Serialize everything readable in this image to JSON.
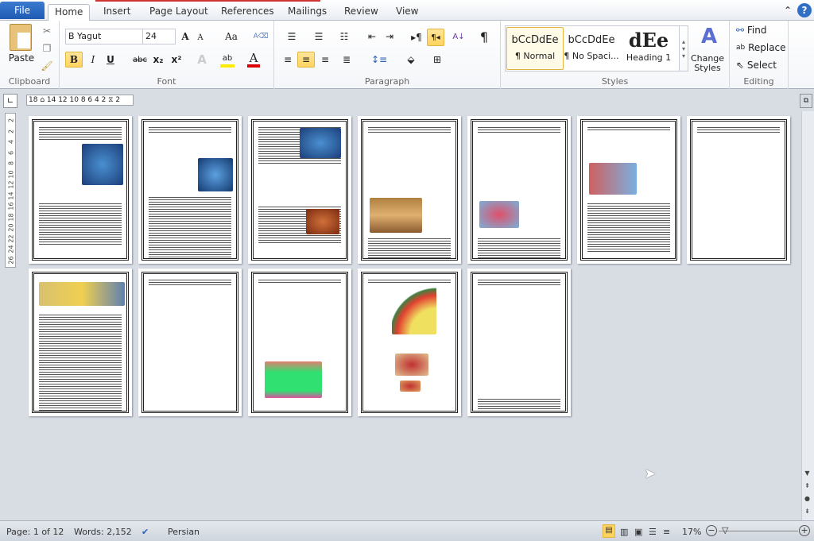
{
  "tabs": {
    "file": "File",
    "items": [
      "Home",
      "Insert",
      "Page Layout",
      "References",
      "Mailings",
      "Review",
      "View"
    ]
  },
  "clipboard": {
    "paste": "Paste",
    "label": "Clipboard"
  },
  "font": {
    "name": "B Yagut",
    "size": "24",
    "label": "Font",
    "grow": "A",
    "shrink": "A",
    "case": "Aa",
    "bold": "B",
    "italic": "I",
    "underline": "U",
    "strike": "abc",
    "sub": "x₂",
    "sup": "x²",
    "color": "A",
    "highlight": "ab"
  },
  "paragraph": {
    "label": "Paragraph",
    "pilcrow": "¶"
  },
  "styles": {
    "label": "Styles",
    "items": [
      {
        "sample": "bCcDdEe",
        "name": "¶ Normal"
      },
      {
        "sample": "bCcDdEe",
        "name": "¶ No Spaci..."
      },
      {
        "sample": "dEe",
        "name": "Heading 1"
      }
    ],
    "change": "Change Styles"
  },
  "editing": {
    "label": "Editing",
    "find": "Find",
    "replace": "Replace",
    "select": "Select"
  },
  "ruler": {
    "h": "18 ⌂ 14 12 10 8 6 4 2 ⧖ 2",
    "v": [
      "2",
      "2",
      "4",
      "6",
      "8",
      "10",
      "12",
      "14",
      "16",
      "18",
      "20",
      "22",
      "24",
      "26"
    ]
  },
  "status": {
    "page": "Page: 1 of 12",
    "words": "Words: 2,152",
    "language": "Persian",
    "zoom": "17%"
  },
  "colors": {
    "accent": "#2b5fb4",
    "highlight": "#ffd45e"
  }
}
